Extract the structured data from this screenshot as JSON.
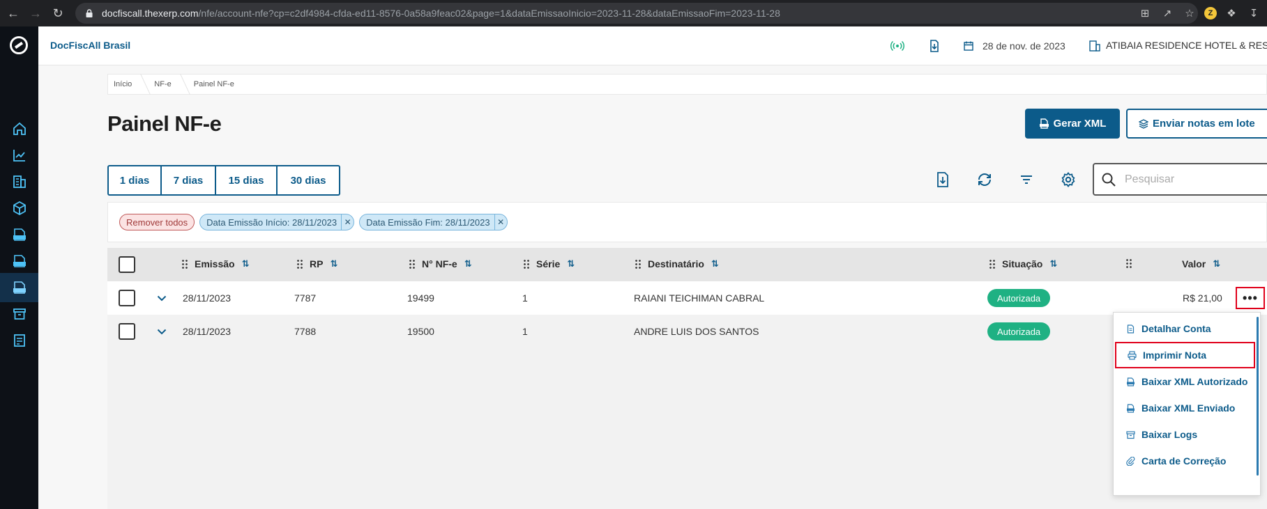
{
  "browser": {
    "url_host": "docfiscall.thexerp.com",
    "url_path": "/nfe/account-nfe?cp=c2df4984-cfda-ed11-8576-0a58a9feac02&page=1&dataEmissaoInicio=2023-11-28&dataEmissaoFim=2023-11-28",
    "profile_letter": "Z"
  },
  "header": {
    "brand": "DocFiscAll Brasil",
    "date": "28 de nov. de 2023",
    "company": "ATIBAIA RESIDENCE HOTEL & RESO"
  },
  "breadcrumb": [
    "Início",
    "NF-e",
    "Painel NF-e"
  ],
  "page": {
    "title": "Painel NF-e",
    "primary_button": "Gerar XML",
    "secondary_button": "Enviar notas em lote"
  },
  "day_filters": [
    "1 dias",
    "7 dias",
    "15 dias",
    "30 dias"
  ],
  "search": {
    "placeholder": "Pesquisar"
  },
  "chips": {
    "remove_all": "Remover todos",
    "items": [
      "Data Emissão Início: 28/11/2023",
      "Data Emissão Fim: 28/11/2023"
    ]
  },
  "table": {
    "columns": {
      "emissao": "Emissão",
      "rp": "RP",
      "nfe": "N° NF-e",
      "serie": "Série",
      "destinatario": "Destinatário",
      "situacao": "Situação",
      "valor": "Valor"
    },
    "rows": [
      {
        "emissao": "28/11/2023",
        "rp": "7787",
        "nfe": "19499",
        "serie": "1",
        "destinatario": "RAIANI TEICHIMAN CABRAL",
        "situacao": "Autorizada",
        "valor": "R$ 21,00"
      },
      {
        "emissao": "28/11/2023",
        "rp": "7788",
        "nfe": "19500",
        "serie": "1",
        "destinatario": "ANDRE LUIS DOS SANTOS",
        "situacao": "Autorizada",
        "valor": ""
      }
    ]
  },
  "menu": {
    "items": [
      "Detalhar Conta",
      "Imprimir Nota",
      "Baixar XML Autorizado",
      "Baixar XML Enviado",
      "Baixar Logs",
      "Carta de Correção"
    ]
  },
  "colors": {
    "brand": "#0c5b8a",
    "success": "#1fb183",
    "highlight": "#e0001a",
    "sidebar": "#0d1117"
  }
}
